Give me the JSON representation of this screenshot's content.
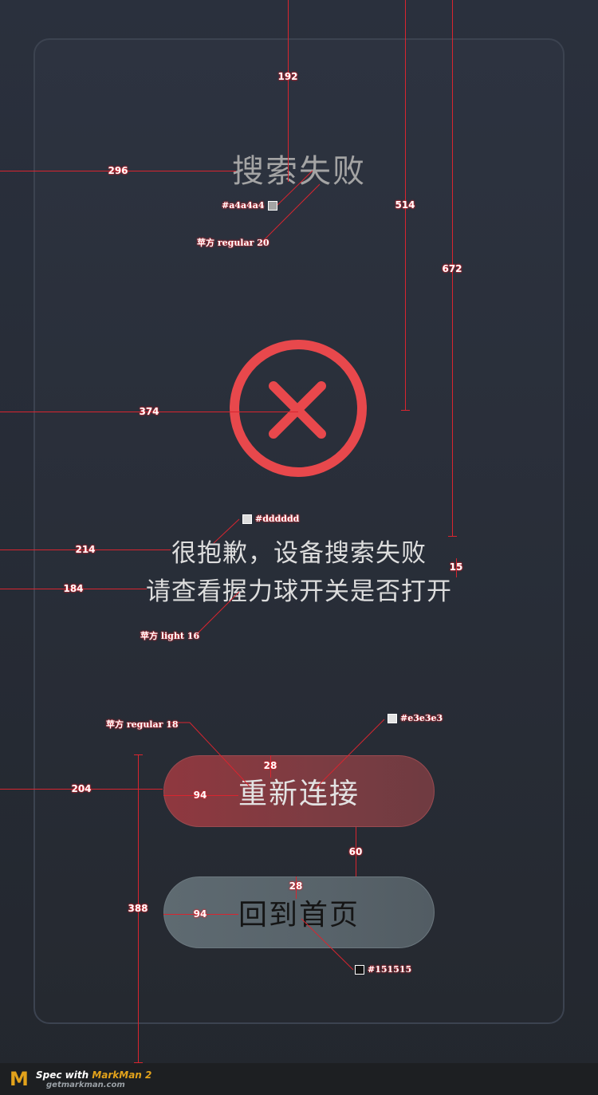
{
  "dialog": {
    "title": "搜索失败",
    "message_line1": "很抱歉，设备搜索失败",
    "message_line2": "请查看握力球开关是否打开",
    "icon": "close-circle-icon",
    "reconnect_label": "重新连接",
    "home_label": "回到首页"
  },
  "colors": {
    "title": "#a4a4a4",
    "message": "#dddddd",
    "icon": "#e8484c",
    "reconnect_text": "#e3e3e3",
    "home_text": "#151515"
  },
  "spec": {
    "dims": {
      "title_top": "192",
      "title_left": "296",
      "icon_center_top": "514",
      "icon_center_left": "374",
      "message_top": "672",
      "line_gap": "15",
      "msg1_left": "214",
      "msg2_left": "184",
      "btn_left": "204",
      "btn_pad_top": "28",
      "btn_pad_left": "94",
      "btn_gap": "60",
      "btn2_pad_top": "28",
      "btn2_pad_left": "94",
      "bottom_block": "388"
    },
    "notes": {
      "title_color": "#a4a4a4",
      "title_font": "苹方 regular 20",
      "message_color": "#dddddd",
      "message_font": "苹方 light 16",
      "button_font": "苹方 regular 18",
      "reconnect_color": "#e3e3e3",
      "home_color": "#151515"
    }
  },
  "footer": {
    "brand_prefix": "Spec with ",
    "brand_name": "MarkMan 2",
    "site": "getmarkman.com"
  }
}
